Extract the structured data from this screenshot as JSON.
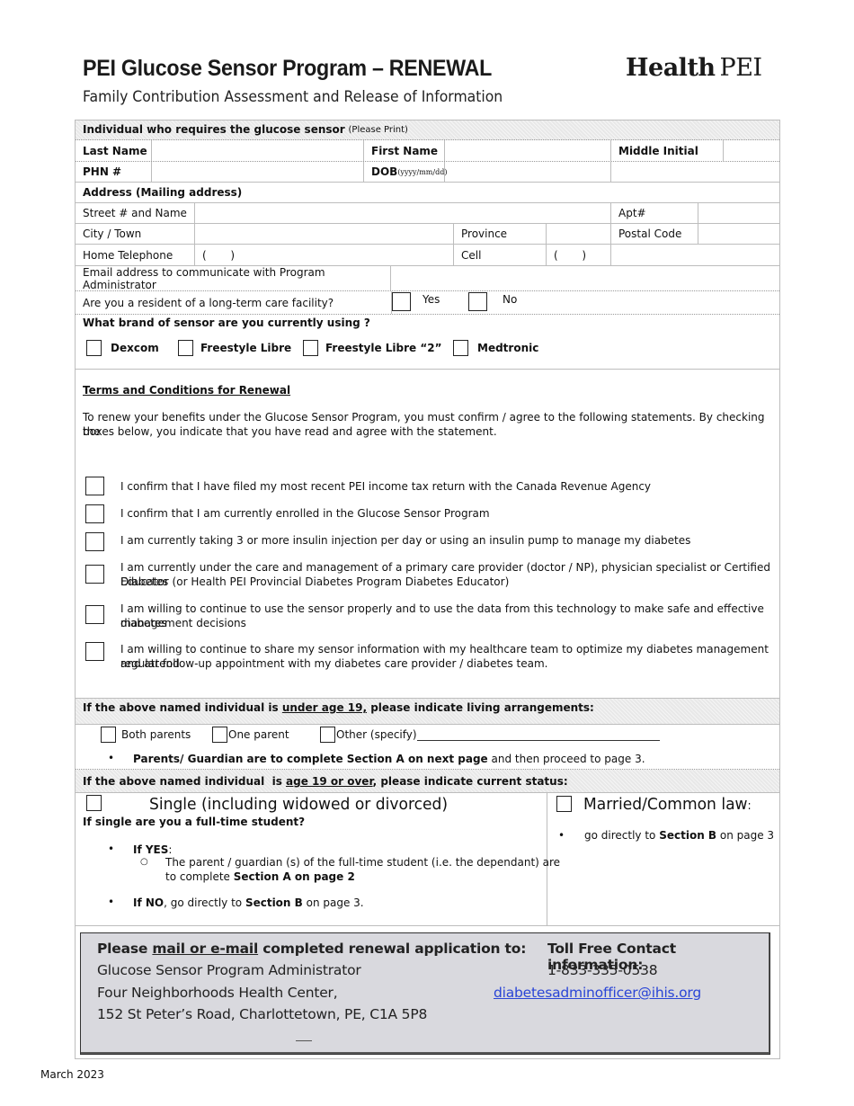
{
  "header": {
    "title": "PEI Glucose Sensor Program – RENEWAL",
    "subtitle": "Family Contribution Assessment and Release of Information",
    "logo_bold": "Health",
    "logo_regular": "PEI"
  },
  "individual": {
    "section_title": "Individual who requires the glucose sensor",
    "section_note": "(Please Print)",
    "last_name_label": "Last Name",
    "last_name_value": "",
    "first_name_label": "First Name",
    "first_name_value": "",
    "middle_initial_label": "Middle Initial",
    "middle_initial_value": "",
    "phn_label": "PHN #",
    "phn_value": "",
    "dob_label": "DOB",
    "dob_format": "(yyyy/mm/dd)",
    "dob_value": ""
  },
  "address": {
    "section_title": "Address (Mailing address)",
    "street_label": "Street # and Name",
    "apt_label": "Apt#",
    "city_label": "City / Town",
    "province_label": "Province",
    "postal_label": "Postal Code",
    "home_phone_label": "Home Telephone",
    "home_phone_value": "(       )",
    "cell_label": "Cell",
    "cell_value": "(       )",
    "email_label": "Email address to communicate with Program Administrator",
    "ltc_question": "Are you a resident of a long-term care facility?",
    "ltc_yes": "Yes",
    "ltc_no": "No"
  },
  "sensor": {
    "question": "What brand of sensor are you currently using ?",
    "options": [
      "Dexcom",
      "Freestyle Libre",
      "Freestyle Libre “2”",
      "Medtronic"
    ]
  },
  "terms": {
    "title": "Terms and Conditions for Renewal",
    "intro_line1": "To renew your benefits under the Glucose Sensor Program, you must confirm / agree to the following statements. By checking the",
    "intro_line2": "boxes below, you indicate that you have read and agree with the statement.",
    "statements": [
      {
        "line1": "I confirm that I have filed my most recent PEI income tax return with the Canada Revenue Agency",
        "line2": ""
      },
      {
        "line1": "I confirm that I am currently enrolled in the Glucose Sensor Program",
        "line2": ""
      },
      {
        "line1": "I am currently taking 3 or more insulin injection per day or using an insulin pump to manage my diabetes",
        "line2": ""
      },
      {
        "line1": "I am currently under the care and management of a primary care provider (doctor / NP), physician specialist or Certified   Diabetes",
        "line2": "Educator (or Health PEI Provincial Diabetes Program Diabetes Educator)"
      },
      {
        "line1": "I am willing to continue to use the sensor properly and to use the data from this technology to make safe and effective diabetes",
        "line2": "management decisions"
      },
      {
        "line1": "I am willing to continue to share my sensor information with my healthcare team to optimize my diabetes management and attend",
        "line2": "regular follow-up appointment with my diabetes care provider / diabetes team."
      }
    ]
  },
  "under19": {
    "heading_pre": "If the above named individual is ",
    "heading_u": "under age 19,",
    "heading_post": " please indicate living arrangements:",
    "options": [
      "Both parents",
      "One parent",
      "Other (specify)"
    ],
    "note_bold": "Parents/ Guardian are to complete Section A on next page",
    "note_rest": " and then proceed to page 3."
  },
  "over19": {
    "heading_pre": "If the above named individual  is ",
    "heading_u": "age 19 or over",
    "heading_post": ", please indicate current status:",
    "single_label": "Single (including widowed or divorced)",
    "student_question": "If single are you a full-time student?",
    "if_yes": "If YES",
    "if_yes_colon": ":",
    "yes_detail_line1": "The parent / guardian (s) of the full-time student (i.e. the dependant) are",
    "yes_detail_line2_pre": "to complete ",
    "yes_detail_line2_bold": "Section A on page 2",
    "if_no": "If NO",
    "if_no_pre": ", go directly to ",
    "if_no_bold": "Section B",
    "if_no_post": " on page 3.",
    "married_label": "Married/Common law",
    "married_colon": ":",
    "married_pre": "go directly to ",
    "married_bold": "Section B",
    "married_post": " on page 3"
  },
  "contact": {
    "mail_pre": "Please ",
    "mail_u": "mail or e-mail",
    "mail_post": " completed renewal application to:",
    "line1": "Glucose Sensor Program Administrator",
    "line2": "Four Neighborhoods Health Center,",
    "line3": "152 St Peter’s Road, Charlottetown, PE, C1A 5P8",
    "toll_free_title": "Toll Free Contact information:",
    "phone": "1-833-335-0538",
    "email": "diabetesadminofficer@ihis.org"
  },
  "footer": {
    "date": "March 2023"
  }
}
